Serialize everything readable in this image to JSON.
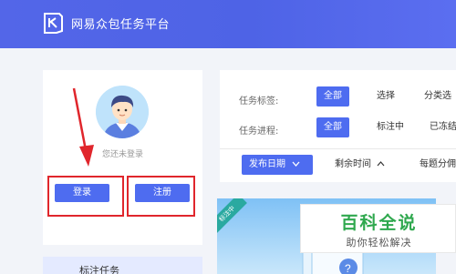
{
  "header": {
    "logo_icon": "app-logo-icon",
    "title": "网易众包任务平台"
  },
  "user_card": {
    "avatar_icon": "user-avatar-icon",
    "status": "您还未登录",
    "login_label": "登录",
    "register_label": "注册",
    "annotation_color": "#e0262c"
  },
  "tag_task_card": {
    "label": "标注任务"
  },
  "filters": {
    "task_tag": {
      "label": "任务标签:",
      "options": [
        {
          "label": "全部",
          "selected": true
        },
        {
          "label": "选择",
          "selected": false
        },
        {
          "label": "分类选",
          "selected": false
        }
      ]
    },
    "task_progress": {
      "label": "任务进程:",
      "options": [
        {
          "label": "全部",
          "selected": true
        },
        {
          "label": "标注中",
          "selected": false
        },
        {
          "label": "已冻结",
          "selected": false
        }
      ]
    }
  },
  "sort_bar": {
    "publish_date": "发布日期",
    "remaining_time": "剩余时间",
    "daily_share": "每题分佣"
  },
  "task_card": {
    "ribbon": "标注中"
  },
  "watermark": {
    "title": "百科全说",
    "subtitle": "助你轻松解决"
  },
  "colors": {
    "accent": "#4e6cf0",
    "header": "#5366e8",
    "highlight": "#e0262c",
    "watermark_green": "#2fa84e"
  }
}
